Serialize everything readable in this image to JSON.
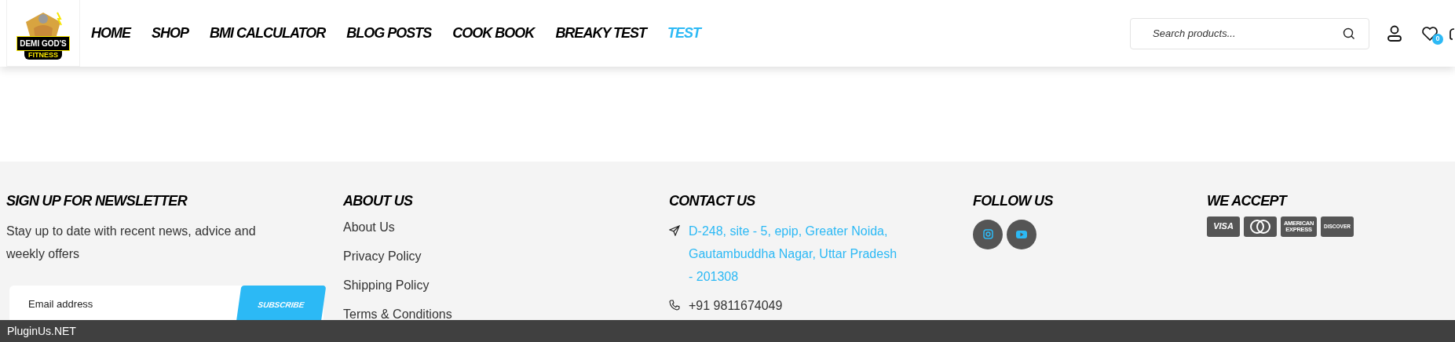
{
  "logo": {
    "title": "DEMI GOD'S",
    "subtitle": "FITNESS"
  },
  "nav": [
    {
      "label": "HOME",
      "selected": false
    },
    {
      "label": "SHOP",
      "selected": false
    },
    {
      "label": "BMI CALCULATOR",
      "selected": false
    },
    {
      "label": "BLOG POSTS",
      "selected": false
    },
    {
      "label": "COOK BOOK",
      "selected": false
    },
    {
      "label": "BREAKY TEST",
      "selected": false
    },
    {
      "label": "TEST",
      "selected": true
    }
  ],
  "search": {
    "placeholder": "Search products..."
  },
  "wishlist": {
    "count": "0"
  },
  "newsletter": {
    "heading": "SIGN UP FOR NEWSLETTER",
    "text": "Stay up to date with recent news, advice and weekly offers",
    "email_placeholder": "Email address",
    "button": "SUBSCRIBE"
  },
  "about": {
    "heading": "ABOUT US",
    "links": [
      "About Us",
      "Privacy Policy",
      "Shipping Policy",
      "Terms & Conditions"
    ]
  },
  "contact": {
    "heading": "CONTACT US",
    "items": [
      {
        "kind": "address",
        "text": "D-248, site - 5, epip, Greater Noida, Gautambuddha Nagar, Uttar Pradesh - 201308"
      },
      {
        "kind": "phone",
        "text": "+91 9811674049"
      }
    ]
  },
  "follow": {
    "heading": "FOLLOW US",
    "links": [
      {
        "kind": "instagram"
      },
      {
        "kind": "youtube"
      }
    ]
  },
  "accept": {
    "heading": "WE ACCEPT",
    "cards": [
      {
        "kind": "visa",
        "text": "VISA"
      },
      {
        "kind": "mastercard"
      },
      {
        "kind": "amex",
        "text": "AMERICAN EXPRESS"
      },
      {
        "kind": "discover",
        "text": "DISCOVER"
      }
    ]
  },
  "bottom_bar": {
    "text": "PluginUs.NET"
  }
}
